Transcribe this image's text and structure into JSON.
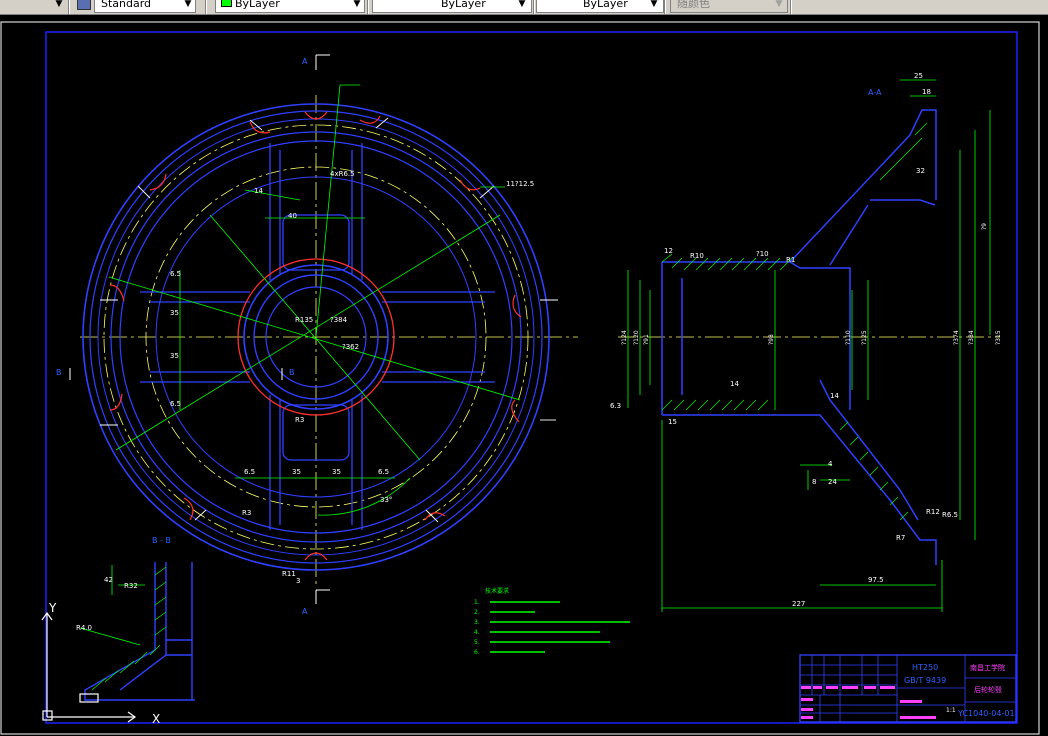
{
  "toolbar": {
    "textstyle": "Standard",
    "color": "ByLayer",
    "linetype": "ByLayer",
    "lineweight": "ByLayer",
    "plotstyle": "随颜色",
    "color_swatch": "#00ff00"
  },
  "drawing": {
    "section_label_top": "A",
    "section_label_bottom": "A",
    "section_label_left": "B",
    "section_label_right": "B",
    "section_view_aa": "A-A",
    "section_view_bb": "B - B",
    "front_dims": {
      "d1": "4xR6.5",
      "d2": "14",
      "d3": "40",
      "d4": "11?12.5",
      "d5": "6.5",
      "d6": "35",
      "d7": "35",
      "d8": "6.5",
      "d9": "R135",
      "d10": "?384",
      "d11": "?362",
      "d12": "R3",
      "d13": "6.5",
      "d14": "35",
      "d15": "35",
      "d16": "6.5",
      "d17": "33°",
      "d18": "R3",
      "d19": "R11",
      "d20": "3"
    },
    "section_dims": {
      "d1": "25",
      "d2": "18",
      "d3": "12",
      "d4": "R10",
      "d5": "?10",
      "d6": "R1",
      "d7": "?9",
      "d8": "?124",
      "d9": "?384",
      "d10": "?120",
      "d11": "?91",
      "d12": "?98",
      "d13": "?110",
      "d14": "?125",
      "d15": "?374",
      "d16": "?315",
      "d17": "14",
      "d18": "14",
      "d19": "6.3",
      "d20": "15",
      "d21": "4",
      "d22": "8",
      "d23": "24",
      "d24": "R12",
      "d25": "R6.5",
      "d26": "R7",
      "d27": "97.5",
      "d28": "227",
      "d29": "32"
    },
    "bb_dims": {
      "d1": "42",
      "d2": "R32",
      "d3": "R4.0"
    },
    "ucs": {
      "y": "Y",
      "x": "X"
    },
    "notes": {
      "title": "技术要求",
      "n1": "1.",
      "n2": "2.",
      "n3": "3.",
      "n4": "4.",
      "n5": "5.",
      "n6": "6."
    },
    "title_block": {
      "material": "HT250",
      "standard": "GB/T 9439",
      "school": "南昌工学院",
      "part_name": "后轮轮毂",
      "drawing_no": "YC1040-04-01",
      "scale": "1:1"
    }
  }
}
